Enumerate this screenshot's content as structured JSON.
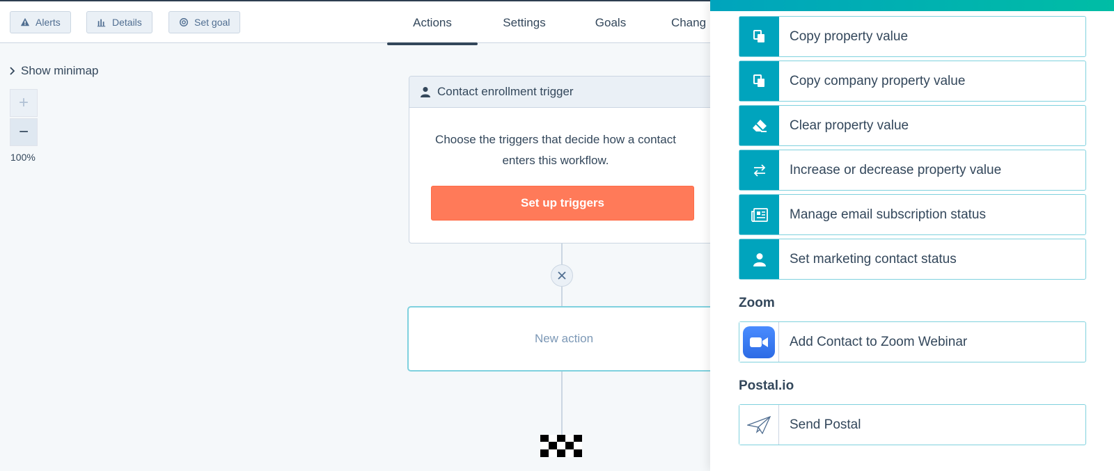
{
  "toolbar": {
    "alerts_label": "Alerts",
    "details_label": "Details",
    "set_goal_label": "Set goal"
  },
  "tabs": [
    {
      "label": "Actions",
      "active": true
    },
    {
      "label": "Settings",
      "active": false
    },
    {
      "label": "Goals",
      "active": false
    },
    {
      "label": "Chang",
      "active": false
    }
  ],
  "canvas": {
    "minimap_label": "Show minimap",
    "zoom_in_symbol": "+",
    "zoom_out_symbol": "−",
    "zoom_level": "100%",
    "trigger": {
      "title": "Contact enrollment trigger",
      "description": "Choose the triggers that decide how a contact enters this workflow.",
      "button_label": "Set up triggers"
    },
    "new_action_label": "New action"
  },
  "panel": {
    "actions": [
      {
        "label": "Copy property value",
        "icon": "copy-icon"
      },
      {
        "label": "Copy company property value",
        "icon": "copy-icon"
      },
      {
        "label": "Clear property value",
        "icon": "eraser-icon"
      },
      {
        "label": "Increase or decrease property value",
        "icon": "arrows-swap-icon"
      },
      {
        "label": "Manage email subscription status",
        "icon": "newsletter-icon"
      },
      {
        "label": "Set marketing contact status",
        "icon": "contact-icon"
      }
    ],
    "zoom_section": {
      "title": "Zoom",
      "action_label": "Add Contact to Zoom Webinar"
    },
    "postal_section": {
      "title": "Postal.io",
      "action_label": "Send Postal"
    }
  },
  "colors": {
    "accent_teal": "#00a4bd",
    "trigger_orange": "#ff7a59",
    "text_dark": "#33475b"
  }
}
